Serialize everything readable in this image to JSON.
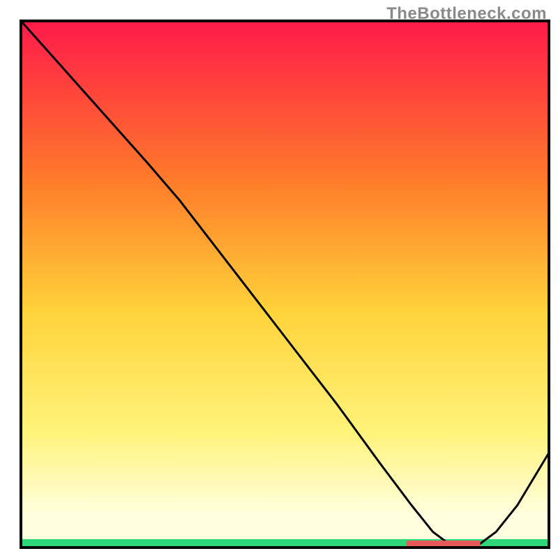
{
  "watermark": "TheBottleneck.com",
  "chart_data": {
    "type": "line",
    "title": "",
    "xlabel": "",
    "ylabel": "",
    "xlim": [
      0,
      100
    ],
    "ylim": [
      0,
      100
    ],
    "axes_visible": false,
    "grid": false,
    "legend": false,
    "background_gradient": {
      "top_color": "#ff1a4b",
      "mid_upper_color": "#ff7a2a",
      "mid_color": "#ffd23a",
      "mid_lower_color": "#fff37a",
      "near_bottom_color": "#ffffe0",
      "bottom_band_color": "#2fd67a"
    },
    "marker": {
      "x": 80,
      "y": 0,
      "label": "",
      "fill": "#e65a5a",
      "width": 14,
      "height": 2
    },
    "frame": {
      "stroke": "#000000",
      "stroke_width": 4,
      "inset_left": 30,
      "inset_top": 30,
      "inset_right": 13,
      "inset_bottom": 15
    },
    "series": [
      {
        "name": "curve",
        "stroke": "#000000",
        "stroke_width": 3,
        "x": [
          0,
          8,
          16,
          24,
          30,
          40,
          50,
          60,
          68,
          74,
          78,
          82,
          86,
          90,
          94,
          100
        ],
        "y": [
          100,
          91,
          82,
          73,
          66,
          53,
          40,
          27,
          16,
          8,
          3,
          0,
          0,
          3,
          8,
          18
        ]
      }
    ]
  }
}
